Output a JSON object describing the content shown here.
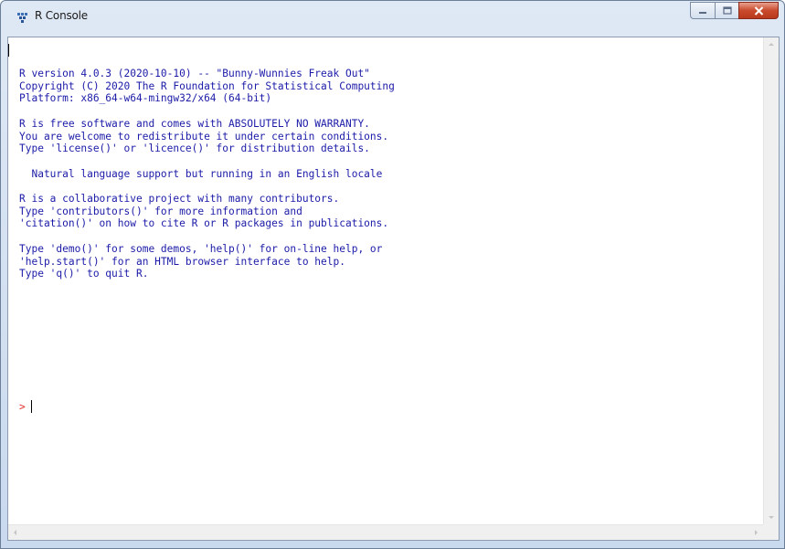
{
  "window": {
    "title": "R Console",
    "icon": "r-logo-icon"
  },
  "caption_buttons": {
    "minimize_icon": "minimize-icon",
    "maximize_icon": "maximize-icon",
    "close_icon": "close-icon"
  },
  "console": {
    "text": "R version 4.0.3 (2020-10-10) -- \"Bunny-Wunnies Freak Out\"\nCopyright (C) 2020 The R Foundation for Statistical Computing\nPlatform: x86_64-w64-mingw32/x64 (64-bit)\n\nR is free software and comes with ABSOLUTELY NO WARRANTY.\nYou are welcome to redistribute it under certain conditions.\nType 'license()' or 'licence()' for distribution details.\n\n  Natural language support but running in an English locale\n\nR is a collaborative project with many contributors.\nType 'contributors()' for more information and\n'citation()' on how to cite R or R packages in publications.\n\nType 'demo()' for some demos, 'help()' for on-line help, or\n'help.start()' for an HTML browser interface to help.\nType 'q()' to quit R.",
    "prompt": ">",
    "input": ""
  },
  "colors": {
    "output_text": "#1b1ba8",
    "prompt": "#e0322a",
    "title_bar": "#dfe9f5",
    "close_button": "#c94a2c"
  }
}
